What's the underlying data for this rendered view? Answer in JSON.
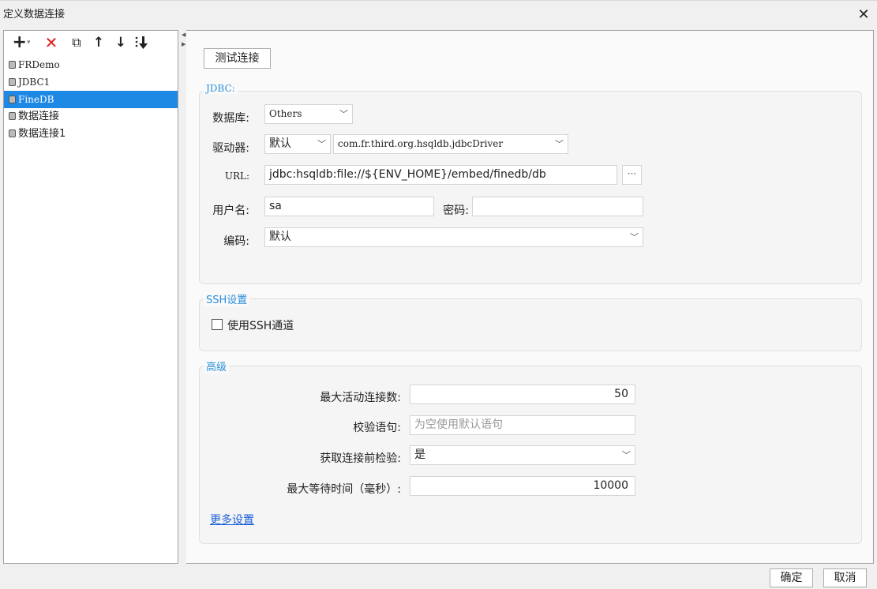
{
  "window": {
    "title": "定义数据连接",
    "close": "✕"
  },
  "toolbar": {
    "add": "+",
    "add_caret": "▾",
    "delete": "✕",
    "copy": "⧉",
    "move_up": "↑",
    "move_down": "↓"
  },
  "connections": [
    {
      "label": "FRDemo",
      "selected": false
    },
    {
      "label": "JDBC1",
      "selected": false
    },
    {
      "label": "FineDB",
      "selected": true
    },
    {
      "label": "数据连接",
      "selected": false
    },
    {
      "label": "数据连接1",
      "selected": false
    }
  ],
  "main": {
    "test_button": "测试连接",
    "jdbc": {
      "group_label": "JDBC:",
      "database_label": "数据库:",
      "database_value": "Others",
      "driver_label": "驱动器:",
      "driver_mode": "默认",
      "driver_class": "com.fr.third.org.hsqldb.jdbcDriver",
      "url_label": "URL:",
      "url_value": "jdbc:hsqldb:file://${ENV_HOME}/embed/finedb/db",
      "url_button": "···",
      "username_label": "用户名:",
      "username_value": "sa",
      "password_label": "密码:",
      "password_value": "",
      "encoding_label": "编码:",
      "encoding_value": "默认"
    },
    "ssh": {
      "group_label": "SSH设置",
      "use_ssh_label": "使用SSH通道",
      "use_ssh_checked": false
    },
    "advanced": {
      "group_label": "高级",
      "max_active_label": "最大活动连接数:",
      "max_active_value": "50",
      "validation_label": "校验语句:",
      "validation_placeholder": "为空使用默认语句",
      "test_before_label": "获取连接前检验:",
      "test_before_value": "是",
      "max_wait_label": "最大等待时间（毫秒）:",
      "max_wait_value": "10000",
      "more_settings": "更多设置"
    }
  },
  "footer": {
    "ok": "确定",
    "cancel": "取消"
  },
  "colors": {
    "accent": "#2a8fd8",
    "selection": "#1e88e5",
    "delete": "#e02020",
    "link": "#1a5fd8"
  }
}
